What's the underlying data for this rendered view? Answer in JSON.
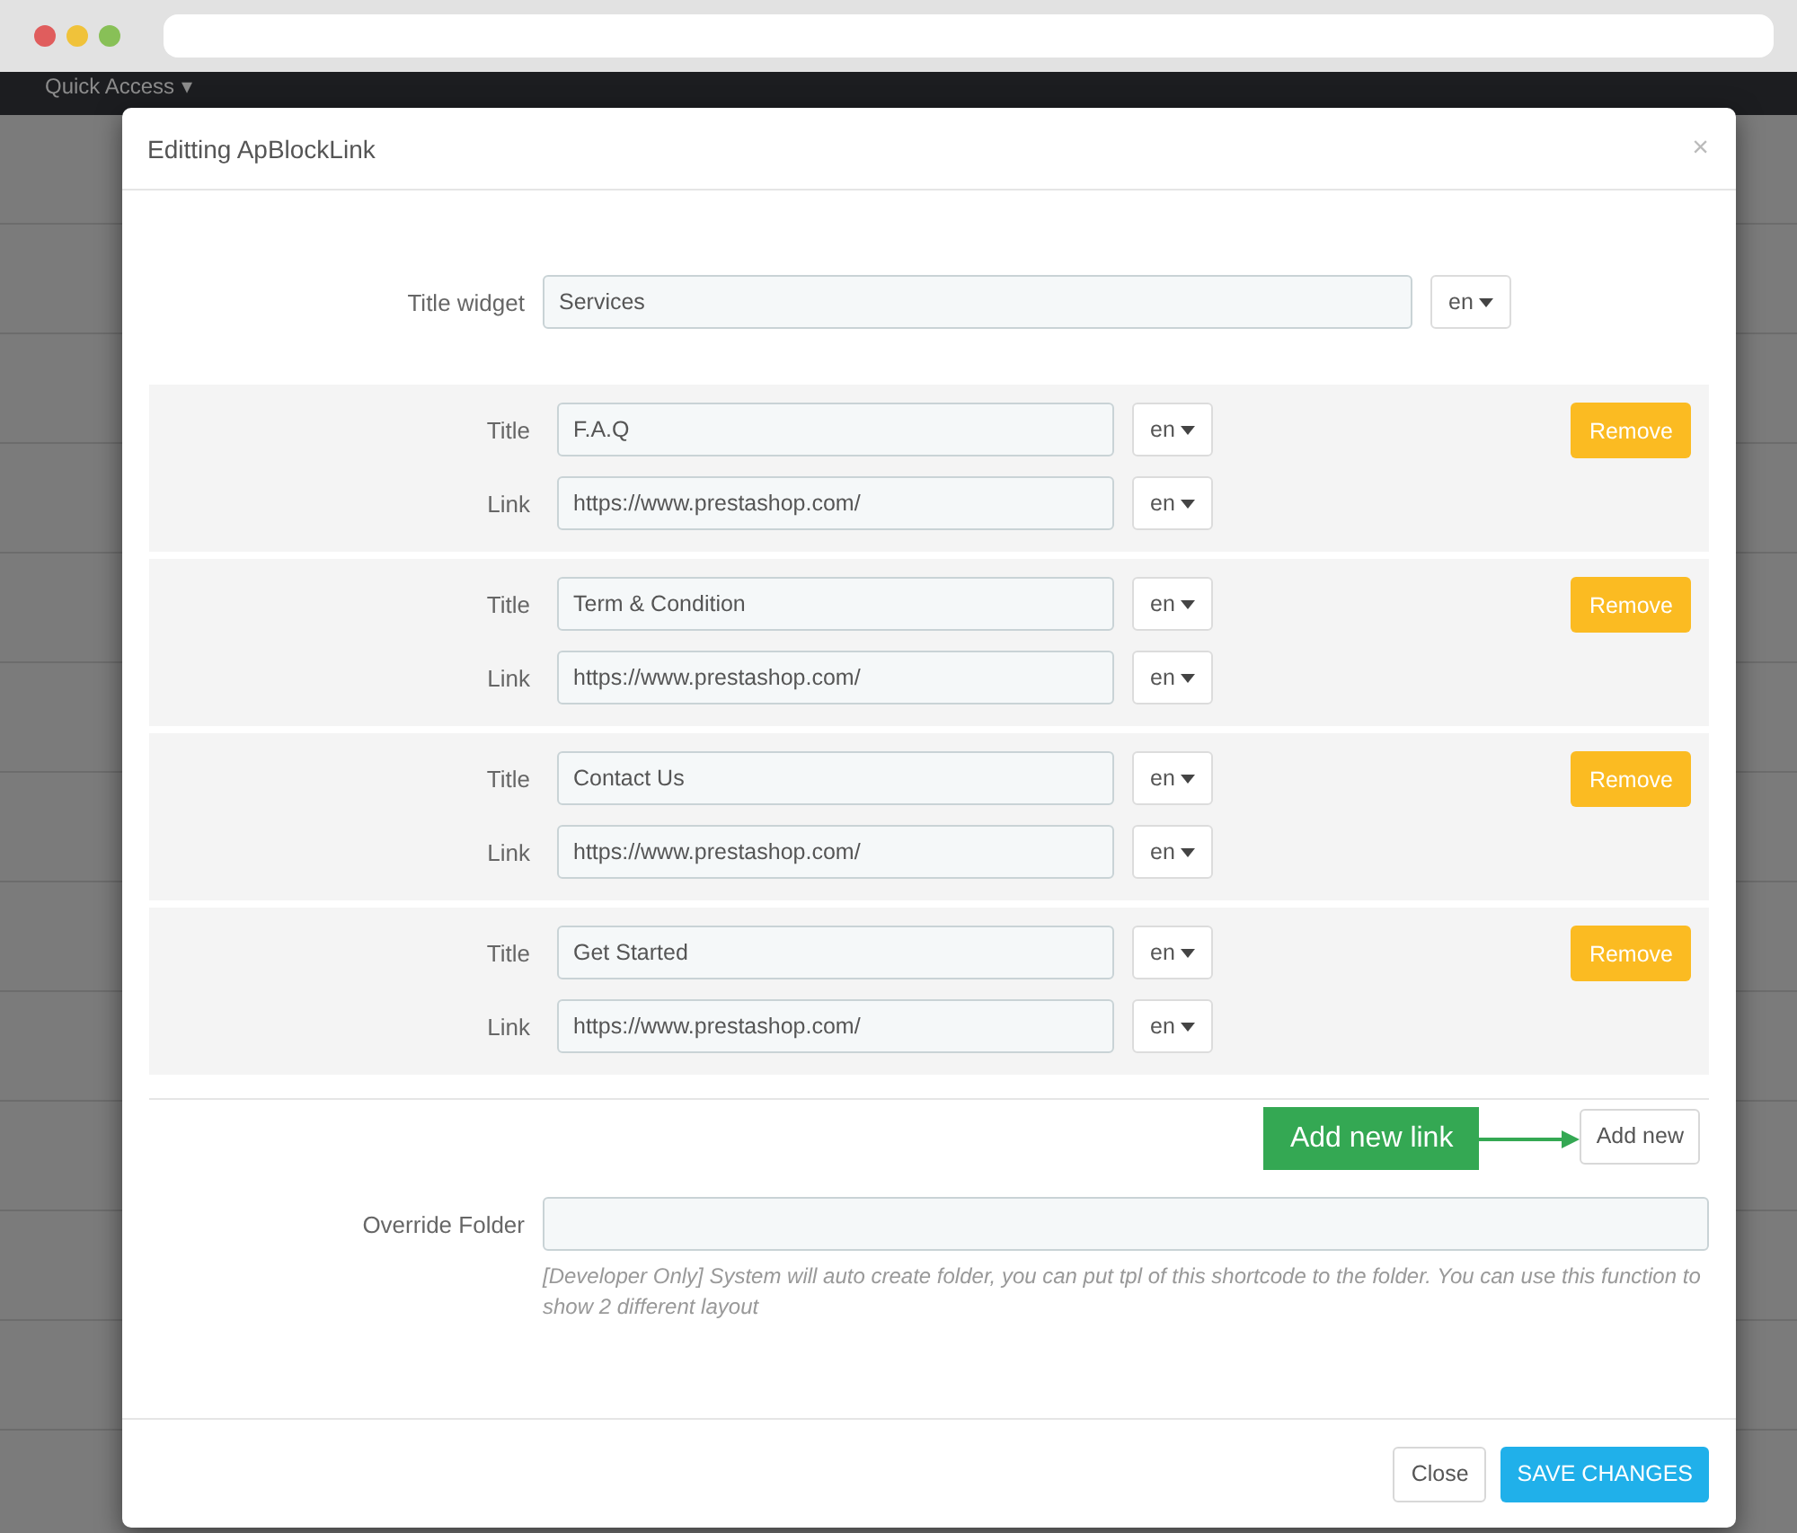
{
  "background": {
    "menu_label": "Quick Access",
    "menu_caret": "▾"
  },
  "modal": {
    "title": "Editting ApBlockLink",
    "close": "×",
    "title_widget": {
      "label": "Title widget",
      "value": "Services",
      "lang": "en"
    },
    "links": [
      {
        "title_label": "Title",
        "title": "F.A.Q",
        "title_lang": "en",
        "link_label": "Link",
        "link": "https://www.prestashop.com/",
        "link_lang": "en",
        "remove": "Remove"
      },
      {
        "title_label": "Title",
        "title": "Term & Condition",
        "title_lang": "en",
        "link_label": "Link",
        "link": "https://www.prestashop.com/",
        "link_lang": "en",
        "remove": "Remove"
      },
      {
        "title_label": "Title",
        "title": "Contact Us",
        "title_lang": "en",
        "link_label": "Link",
        "link": "https://www.prestashop.com/",
        "link_lang": "en",
        "remove": "Remove"
      },
      {
        "title_label": "Title",
        "title": "Get Started",
        "title_lang": "en",
        "link_label": "Link",
        "link": "https://www.prestashop.com/",
        "link_lang": "en",
        "remove": "Remove"
      }
    ],
    "annotation": "Add new link",
    "add_new": "Add new",
    "override": {
      "label": "Override Folder",
      "help": "[Developer Only] System will auto create folder, you can put tpl of this shortcode to the folder. You can use this function to show 2 different layout"
    },
    "footer": {
      "close": "Close",
      "save": "SAVE CHANGES"
    }
  }
}
